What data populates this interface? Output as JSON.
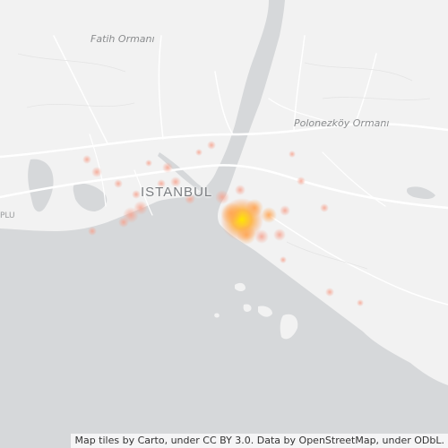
{
  "labels": {
    "fatih": "Fatih Ormanı",
    "polonezkoy": "Polonezköy Ormanı",
    "istanbul": "ISTANBUL",
    "left_edge": "PLU"
  },
  "attribution": "Map tiles by Carto, under CC BY 3.0. Data by OpenStreetMap, under ODbL.",
  "colors": {
    "water": "#d6d8da",
    "land": "#f2f2f2",
    "road": "#ffffff",
    "hot_center": "#ffd400",
    "warm": "#ffa552",
    "cool": "#f6a38f"
  }
}
